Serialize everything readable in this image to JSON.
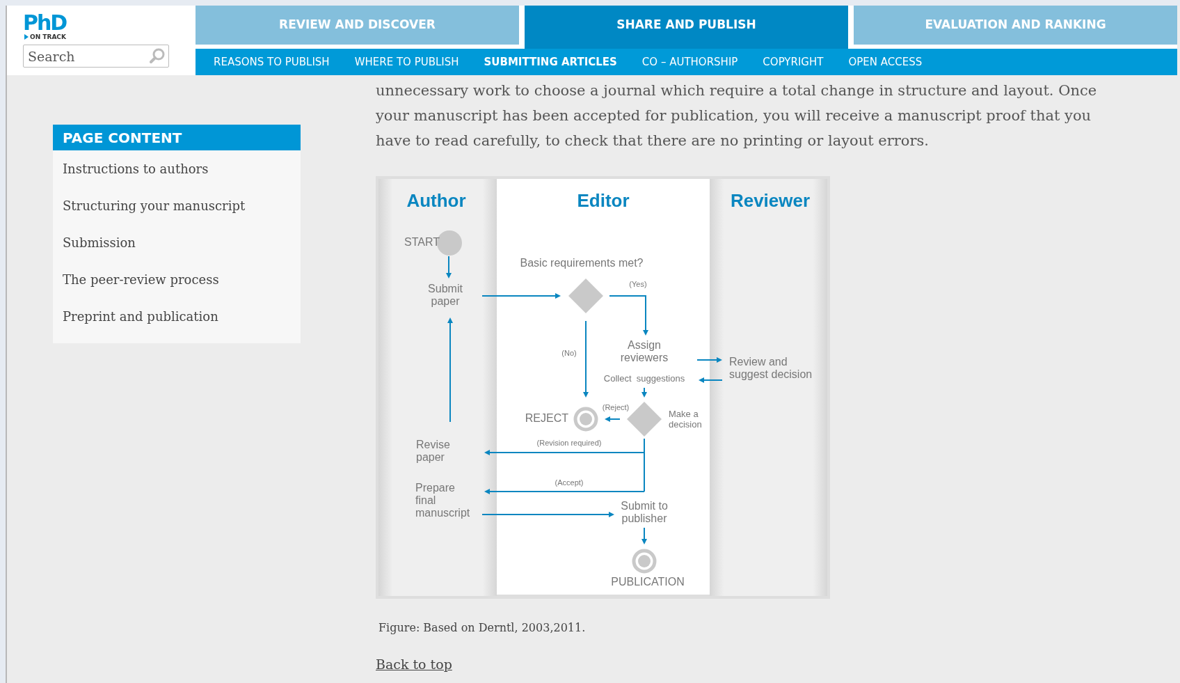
{
  "header": {
    "logo": {
      "title": "PhD",
      "subtitle": "ON TRACK"
    },
    "search": {
      "placeholder": "Search"
    }
  },
  "main_tabs": [
    {
      "label": "REVIEW AND DISCOVER",
      "selected": false
    },
    {
      "label": "SHARE AND PUBLISH",
      "selected": true
    },
    {
      "label": "EVALUATION AND RANKING",
      "selected": false
    }
  ],
  "sub_tabs": [
    {
      "label": "REASONS TO PUBLISH",
      "selected": false
    },
    {
      "label": "WHERE TO PUBLISH",
      "selected": false
    },
    {
      "label": "SUBMITTING ARTICLES",
      "selected": true
    },
    {
      "label": "CO – AUTHORSHIP",
      "selected": false
    },
    {
      "label": "COPYRIGHT",
      "selected": false
    },
    {
      "label": "OPEN ACCESS",
      "selected": false
    }
  ],
  "sidebar": {
    "title": "PAGE CONTENT",
    "items": [
      "Instructions to authors",
      "Structuring your manuscript",
      "Submission",
      "The peer-review process",
      "Preprint and publication"
    ]
  },
  "article": {
    "paragraph": "unnecessary work to choose a journal which require a total change in structure and layout. Once your manuscript has been accepted for publication, you will receive a manuscript proof that you have to read carefully, to check that there are no printing or layout errors.",
    "figure": {
      "lanes": [
        "Author",
        "Editor",
        "Reviewer"
      ],
      "labels": [
        {
          "kind": "terminal",
          "lines": [
            "START"
          ]
        },
        {
          "kind": "step",
          "lines": [
            "Submit",
            "paper"
          ]
        },
        {
          "kind": "step",
          "lines": [
            "Basic requirements met?"
          ]
        },
        {
          "kind": "branch",
          "lines": [
            "(Yes)"
          ]
        },
        {
          "kind": "branch",
          "lines": [
            "(No)"
          ]
        },
        {
          "kind": "step",
          "lines": [
            "Assign",
            "reviewers"
          ]
        },
        {
          "kind": "step",
          "lines": [
            "Review and",
            "suggest decision"
          ]
        },
        {
          "kind": "note",
          "lines": [
            "Collect  suggestions"
          ]
        },
        {
          "kind": "note",
          "lines": [
            "Make a",
            "decision"
          ]
        },
        {
          "kind": "branch",
          "lines": [
            "(Reject)"
          ]
        },
        {
          "kind": "terminal",
          "lines": [
            "REJECT"
          ]
        },
        {
          "kind": "step",
          "lines": [
            "Revise",
            "paper"
          ]
        },
        {
          "kind": "branch",
          "lines": [
            "(Revision required)"
          ]
        },
        {
          "kind": "branch",
          "lines": [
            "(Accept)"
          ]
        },
        {
          "kind": "step",
          "lines": [
            "Prepare",
            "final",
            "manuscript"
          ]
        },
        {
          "kind": "step",
          "lines": [
            "Submit to",
            "publisher"
          ]
        },
        {
          "kind": "terminal",
          "lines": [
            "PUBLICATION"
          ]
        }
      ]
    },
    "caption": "Figure: Based on Derntl, 2003,2011.",
    "back_link": "Back to top"
  }
}
